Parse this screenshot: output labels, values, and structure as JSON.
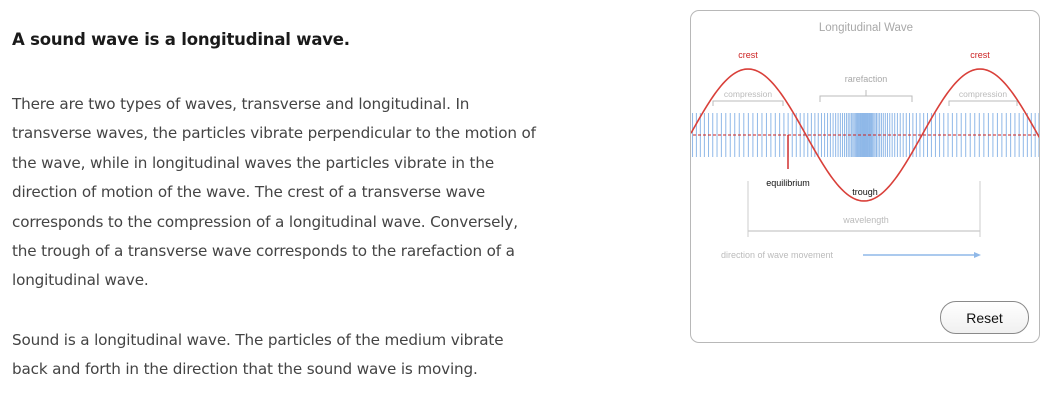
{
  "heading": "A sound wave is a longitudinal wave.",
  "paragraph1": "There are two types of waves, transverse and longitudinal. In transverse waves, the particles vibrate perpendicular to the motion of the wave, while in longitudinal waves the particles vibrate in the direction of motion of the wave. The crest of a transverse wave corresponds to the compression of a longitudinal wave. Conversely, the trough of a transverse wave corresponds to the rarefaction of a longitudinal wave.",
  "paragraph2": "Sound is a longitudinal wave. The particles of the medium vibrate back and forth in the direction that the sound wave is moving.",
  "simulation": {
    "title": "Longitudinal Wave",
    "labels": {
      "crest_left": "crest",
      "crest_right": "crest",
      "rarefaction": "rarefaction",
      "compression_left": "compression",
      "compression_right": "compression",
      "equilibrium": "equilibrium",
      "trough": "trough",
      "wavelength": "wavelength",
      "direction": "direction of wave movement"
    },
    "reset_label": "Reset",
    "colors": {
      "wave": "#d9403a",
      "particles": "#8fb8e8",
      "arrow": "#8fb8e8",
      "label_red": "#cc2222",
      "label_gray": "#a8a8a8"
    }
  }
}
